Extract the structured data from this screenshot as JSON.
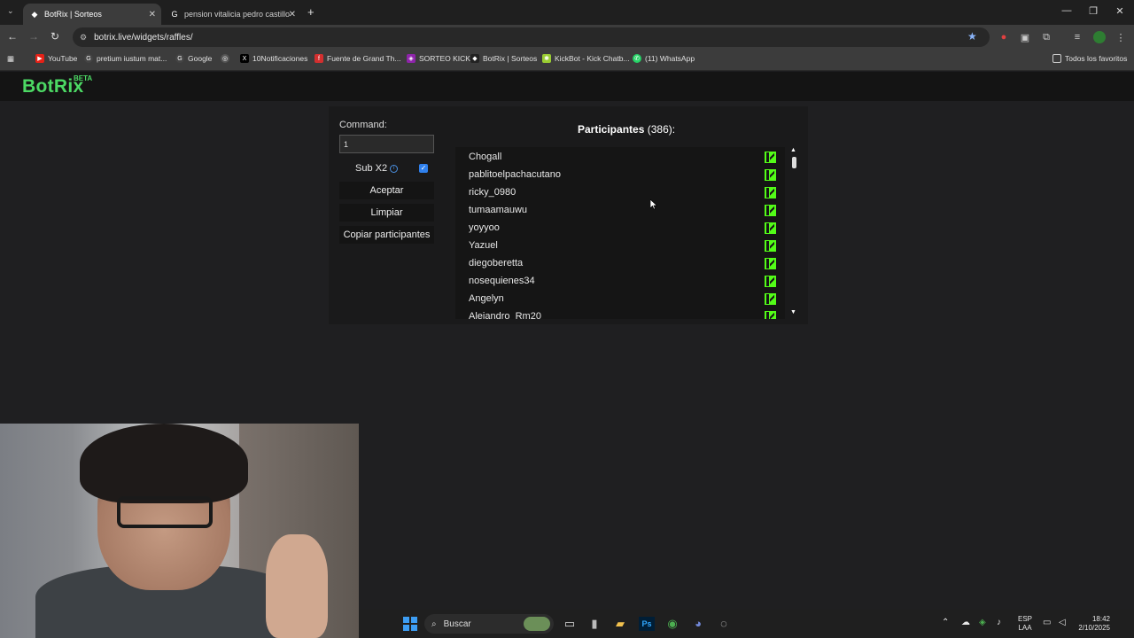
{
  "browser": {
    "tabs": [
      {
        "title": "BotRix | Sorteos",
        "active": true
      },
      {
        "title": "pension vitalicia pedro castillo",
        "active": false
      }
    ],
    "url": "botrix.live/widgets/raffles/",
    "bookmarks": [
      "YouTube",
      "pretium iustum mat...",
      "Google",
      "10Notificaciones",
      "Fuente de Grand Th...",
      "SORTEO KICK",
      "BotRix | Sorteos",
      "KickBot - Kick Chatb...",
      "(11) WhatsApp"
    ],
    "all_bookmarks": "Todos los favoritos"
  },
  "site": {
    "logo": "BotRix",
    "beta": "BETA"
  },
  "raffle": {
    "command_label": "Command:",
    "command_value": "1",
    "sub_label": "Sub X2",
    "sub_checked": true,
    "accept_label": "Aceptar",
    "clear_label": "Limpiar",
    "copy_label": "Copiar participantes",
    "participants_title": "Participantes",
    "participants_count": "(386):",
    "participants": [
      "Chogall",
      "pablitoelpachacutano",
      "ricky_0980",
      "tumaamauwu",
      "yoyyoo",
      "Yazuel",
      "diegoberetta",
      "nosequienes34",
      "Angelyn",
      "Alejandro_Rm20"
    ]
  },
  "taskbar": {
    "search": "Buscar",
    "lang_top": "ESP",
    "lang_bottom": "LAA",
    "time": "18:42",
    "date": "2/10/2025"
  },
  "colors": {
    "brand_green": "#4cd964",
    "kick_green": "#53fc18",
    "accent_blue": "#2f80ed"
  }
}
